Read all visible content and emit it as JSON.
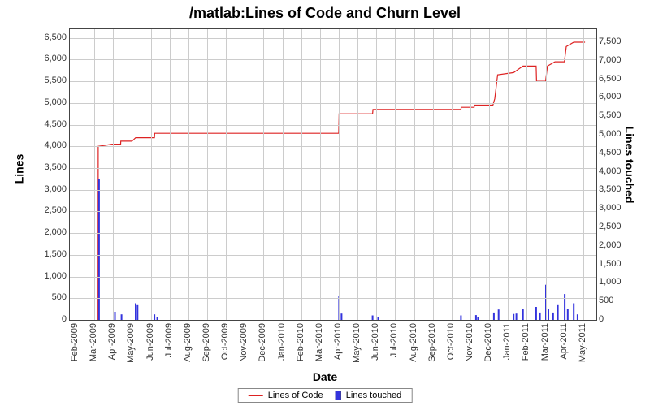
{
  "chart_data": {
    "type": "line+bar",
    "title": "/matlab:Lines of Code and Churn Level",
    "xlabel": "Date",
    "y1label": "Lines",
    "y2label": "Lines touched",
    "x_categories": [
      "Feb-2009",
      "Mar-2009",
      "Apr-2009",
      "May-2009",
      "Jun-2009",
      "Jul-2009",
      "Aug-2009",
      "Sep-2009",
      "Oct-2009",
      "Nov-2009",
      "Dec-2009",
      "Jan-2010",
      "Feb-2010",
      "Mar-2010",
      "Apr-2010",
      "May-2010",
      "Jun-2010",
      "Jul-2010",
      "Aug-2010",
      "Sep-2010",
      "Oct-2010",
      "Nov-2010",
      "Dec-2010",
      "Jan-2011",
      "Feb-2011",
      "Mar-2011",
      "Apr-2011",
      "May-2011"
    ],
    "y1_ticks": [
      0,
      500,
      1000,
      1500,
      2000,
      2500,
      3000,
      3500,
      4000,
      4500,
      5000,
      5500,
      6000,
      6500
    ],
    "y1_range": [
      0,
      6700
    ],
    "y2_ticks": [
      0,
      500,
      1000,
      1500,
      2000,
      2500,
      3000,
      3500,
      4000,
      4500,
      5000,
      5500,
      6000,
      6500,
      7000,
      7500
    ],
    "y2_range": [
      0,
      7850
    ],
    "legend": {
      "loc": "Lines of Code",
      "touched": "Lines touched"
    },
    "series": [
      {
        "name": "Lines of Code",
        "axis": "y1",
        "type": "line",
        "color": "#d22",
        "points": [
          {
            "x": "Mar-2009",
            "f": 0.2,
            "y": 0
          },
          {
            "x": "Mar-2009",
            "f": 0.21,
            "y": 4000
          },
          {
            "x": "Mar-2009",
            "f": 0.95,
            "y": 4050
          },
          {
            "x": "Apr-2009",
            "f": 0.4,
            "y": 4050
          },
          {
            "x": "Apr-2009",
            "f": 0.41,
            "y": 4120
          },
          {
            "x": "May-2009",
            "f": 0.0,
            "y": 4120
          },
          {
            "x": "May-2009",
            "f": 0.2,
            "y": 4200
          },
          {
            "x": "Jun-2009",
            "f": 0.2,
            "y": 4200
          },
          {
            "x": "Jun-2009",
            "f": 0.21,
            "y": 4300
          },
          {
            "x": "Apr-2010",
            "f": 0.0,
            "y": 4300
          },
          {
            "x": "Apr-2010",
            "f": 0.02,
            "y": 4750
          },
          {
            "x": "May-2010",
            "f": 0.8,
            "y": 4750
          },
          {
            "x": "May-2010",
            "f": 0.82,
            "y": 4850
          },
          {
            "x": "Oct-2010",
            "f": 0.5,
            "y": 4850
          },
          {
            "x": "Oct-2010",
            "f": 0.51,
            "y": 4900
          },
          {
            "x": "Nov-2010",
            "f": 0.2,
            "y": 4900
          },
          {
            "x": "Nov-2010",
            "f": 0.22,
            "y": 4950
          },
          {
            "x": "Dec-2010",
            "f": 0.2,
            "y": 4950
          },
          {
            "x": "Dec-2010",
            "f": 0.3,
            "y": 5100
          },
          {
            "x": "Dec-2010",
            "f": 0.45,
            "y": 5650
          },
          {
            "x": "Jan-2011",
            "f": 0.3,
            "y": 5700
          },
          {
            "x": "Jan-2011",
            "f": 0.8,
            "y": 5850
          },
          {
            "x": "Feb-2011",
            "f": 0.5,
            "y": 5850
          },
          {
            "x": "Feb-2011",
            "f": 0.52,
            "y": 5500
          },
          {
            "x": "Mar-2011",
            "f": 0.0,
            "y": 5500
          },
          {
            "x": "Mar-2011",
            "f": 0.1,
            "y": 5850
          },
          {
            "x": "Mar-2011",
            "f": 0.5,
            "y": 5950
          },
          {
            "x": "Apr-2011",
            "f": 0.0,
            "y": 5950
          },
          {
            "x": "Apr-2011",
            "f": 0.1,
            "y": 6300
          },
          {
            "x": "Apr-2011",
            "f": 0.5,
            "y": 6400
          },
          {
            "x": "May-2011",
            "f": 0.1,
            "y": 6400
          }
        ]
      },
      {
        "name": "Lines touched",
        "axis": "y2",
        "type": "bar",
        "color": "#33d",
        "points": [
          {
            "x": "Mar-2009",
            "f": 0.25,
            "y": 3800
          },
          {
            "x": "Apr-2009",
            "f": 0.1,
            "y": 220
          },
          {
            "x": "Apr-2009",
            "f": 0.45,
            "y": 150
          },
          {
            "x": "May-2009",
            "f": 0.2,
            "y": 450
          },
          {
            "x": "May-2009",
            "f": 0.3,
            "y": 400
          },
          {
            "x": "Jun-2009",
            "f": 0.2,
            "y": 150
          },
          {
            "x": "Jun-2009",
            "f": 0.35,
            "y": 80
          },
          {
            "x": "Apr-2010",
            "f": 0.02,
            "y": 650
          },
          {
            "x": "Apr-2010",
            "f": 0.15,
            "y": 170
          },
          {
            "x": "May-2010",
            "f": 0.8,
            "y": 120
          },
          {
            "x": "Jun-2010",
            "f": 0.1,
            "y": 80
          },
          {
            "x": "Oct-2010",
            "f": 0.5,
            "y": 120
          },
          {
            "x": "Nov-2010",
            "f": 0.3,
            "y": 130
          },
          {
            "x": "Nov-2010",
            "f": 0.41,
            "y": 70
          },
          {
            "x": "Dec-2010",
            "f": 0.25,
            "y": 200
          },
          {
            "x": "Dec-2010",
            "f": 0.5,
            "y": 280
          },
          {
            "x": "Jan-2011",
            "f": 0.3,
            "y": 160
          },
          {
            "x": "Jan-2011",
            "f": 0.45,
            "y": 170
          },
          {
            "x": "Jan-2011",
            "f": 0.8,
            "y": 300
          },
          {
            "x": "Feb-2011",
            "f": 0.5,
            "y": 350
          },
          {
            "x": "Feb-2011",
            "f": 0.7,
            "y": 200
          },
          {
            "x": "Mar-2011",
            "f": 0.02,
            "y": 950
          },
          {
            "x": "Mar-2011",
            "f": 0.15,
            "y": 300
          },
          {
            "x": "Mar-2011",
            "f": 0.4,
            "y": 200
          },
          {
            "x": "Mar-2011",
            "f": 0.65,
            "y": 400
          },
          {
            "x": "Apr-2011",
            "f": 0.02,
            "y": 700
          },
          {
            "x": "Apr-2011",
            "f": 0.18,
            "y": 300
          },
          {
            "x": "Apr-2011",
            "f": 0.5,
            "y": 450
          },
          {
            "x": "Apr-2011",
            "f": 0.7,
            "y": 150
          }
        ]
      }
    ]
  }
}
